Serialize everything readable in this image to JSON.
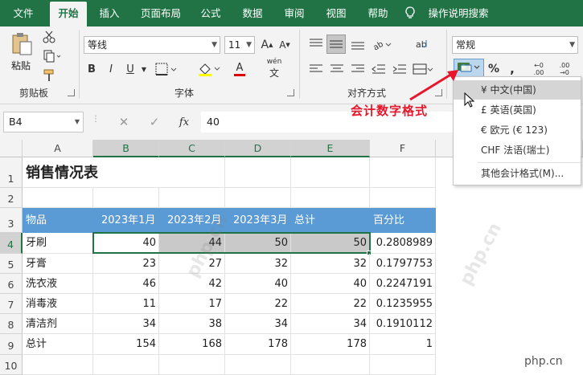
{
  "tabs": [
    "文件",
    "开始",
    "插入",
    "页面布局",
    "公式",
    "数据",
    "审阅",
    "视图",
    "帮助",
    "操作说明搜索"
  ],
  "ribbon": {
    "paste_label": "粘贴",
    "clipboard_group": "剪贴板",
    "font_name": "等线",
    "font_size": "11",
    "bold": "B",
    "italic": "I",
    "underline": "U",
    "font_group": "字体",
    "align_group": "对齐方式",
    "number_format": "常规",
    "percent": "%",
    "comma": ",",
    "accounting_icon": "accounting-number-format-icon",
    "wen_label": "wén",
    "font_color_glyph": "A",
    "dec_increase": "←0 .00",
    "dec_decrease": ".00 →0"
  },
  "formula_bar": {
    "name_box": "B4",
    "fx": "fx",
    "value": "40"
  },
  "columns": [
    "A",
    "B",
    "C",
    "D",
    "E",
    "F"
  ],
  "rows": [
    "1",
    "2",
    "3",
    "4",
    "5",
    "6",
    "7",
    "8",
    "9",
    "10"
  ],
  "sheet": {
    "title": "销售情况表",
    "headers": [
      "物品",
      "2023年1月",
      "2023年2月",
      "2023年3月",
      "总计",
      "百分比"
    ],
    "data": [
      [
        "牙刷",
        "40",
        "44",
        "50",
        "50",
        "0.2808989"
      ],
      [
        "牙膏",
        "23",
        "27",
        "32",
        "32",
        "0.1797753"
      ],
      [
        "洗衣液",
        "46",
        "42",
        "40",
        "40",
        "0.2247191"
      ],
      [
        "消毒液",
        "11",
        "17",
        "22",
        "22",
        "0.1235955"
      ],
      [
        "清洁剂",
        "34",
        "38",
        "34",
        "34",
        "0.1910112"
      ],
      [
        "总计",
        "154",
        "168",
        "178",
        "178",
        "1"
      ]
    ]
  },
  "dropdown": {
    "items": [
      "¥ 中文(中国)",
      "£ 英语(英国)",
      "€ 欧元 (€ 123)",
      "CHF 法语(瑞士)",
      "其他会计格式(M)..."
    ]
  },
  "callout": "会计数字格式",
  "watermark": "php.cn",
  "colors": {
    "excel_green": "#217346",
    "header_blue": "#5b9bd5",
    "callout_red": "#e8162b"
  }
}
